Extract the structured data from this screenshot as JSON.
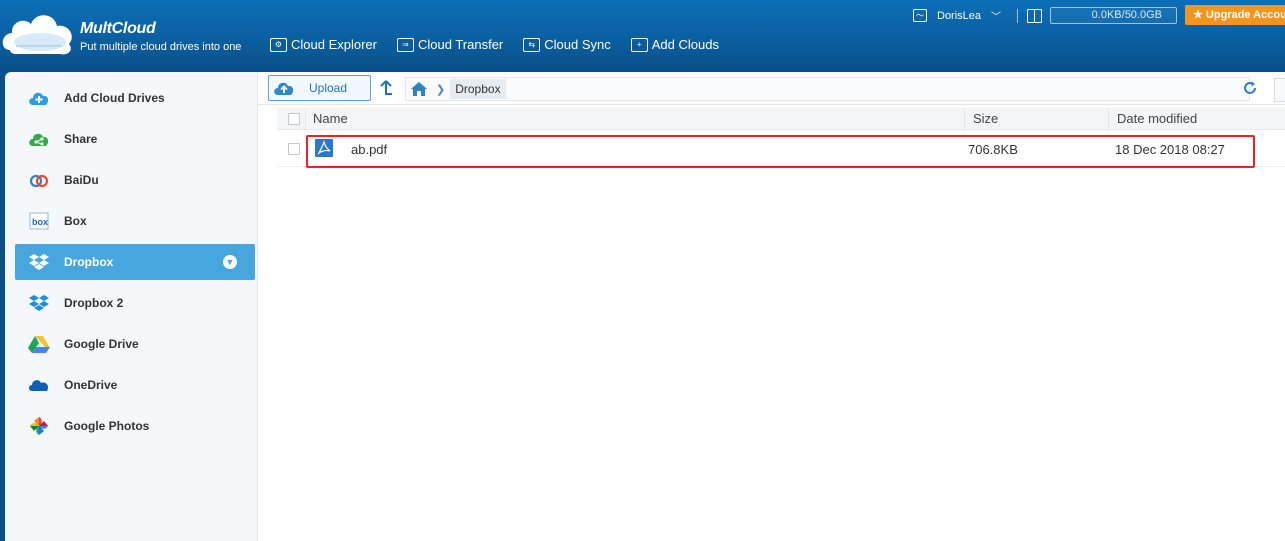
{
  "header": {
    "brand": "MultCloud",
    "slogan": "Put multiple cloud drives into one",
    "nav": [
      {
        "label": "Cloud Explorer",
        "icon": "cloud-explorer-icon"
      },
      {
        "label": "Cloud Transfer",
        "icon": "cloud-transfer-icon"
      },
      {
        "label": "Cloud Sync",
        "icon": "cloud-sync-icon"
      },
      {
        "label": "Add Clouds",
        "icon": "add-clouds-icon"
      }
    ],
    "username": "DorisLea",
    "storage": "0.0KB/50.0GB",
    "upgrade": "★ Upgrade Account"
  },
  "sidebar": {
    "items": [
      {
        "label": "Add Cloud Drives",
        "icon": "add-cloud-icon"
      },
      {
        "label": "Share",
        "icon": "share-icon"
      },
      {
        "label": "BaiDu",
        "icon": "baidu-icon"
      },
      {
        "label": "Box",
        "icon": "box-icon"
      },
      {
        "label": "Dropbox",
        "icon": "dropbox-icon",
        "active": true
      },
      {
        "label": "Dropbox 2",
        "icon": "dropbox-icon"
      },
      {
        "label": "Google Drive",
        "icon": "google-drive-icon"
      },
      {
        "label": "OneDrive",
        "icon": "onedrive-icon"
      },
      {
        "label": "Google Photos",
        "icon": "google-photos-icon"
      }
    ]
  },
  "toolbar": {
    "upload_label": "Upload",
    "breadcrumb": [
      "Dropbox"
    ]
  },
  "table": {
    "columns": [
      "Name",
      "Size",
      "Date modified"
    ],
    "rows": [
      {
        "name": "ab.pdf",
        "size": "706.8KB",
        "date": "18 Dec 2018 08:27",
        "icon": "pdf-icon"
      }
    ]
  },
  "colors": {
    "header_bg": "#0b5fa0",
    "active_item": "#48a6df",
    "upgrade": "#f7941d",
    "highlight_border": "#e32626"
  }
}
